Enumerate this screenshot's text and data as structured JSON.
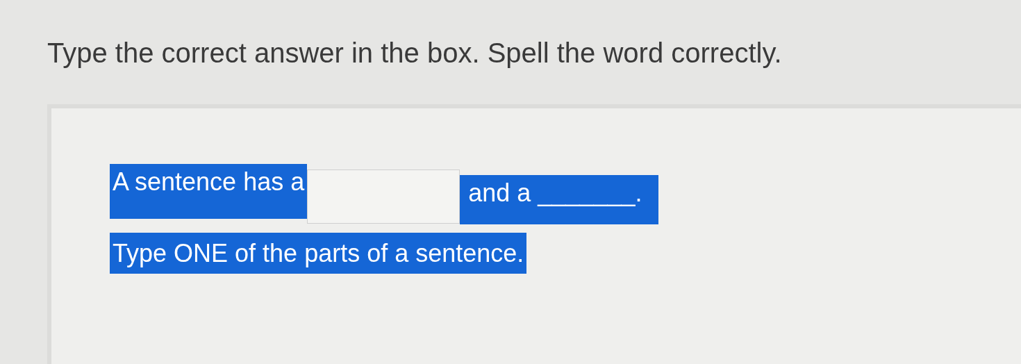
{
  "instruction": "Type the correct answer in the box. Spell the word correctly.",
  "question": {
    "before": "A sentence has a",
    "after": "and a _______.",
    "hint": "Type ONE of the parts of a sentence."
  }
}
